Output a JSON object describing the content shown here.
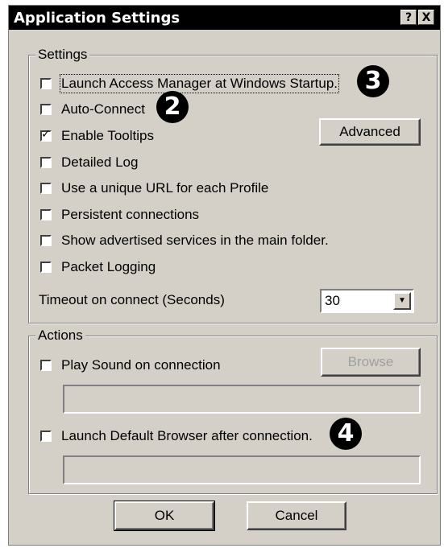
{
  "window": {
    "title": "Application Settings",
    "help_label": "?",
    "close_label": "X"
  },
  "settings": {
    "legend": "Settings",
    "options": [
      {
        "label": "Launch Access Manager at Windows Startup.",
        "checked": false
      },
      {
        "label": "Auto-Connect",
        "checked": false
      },
      {
        "label": "Enable Tooltips",
        "checked": true
      },
      {
        "label": "Detailed Log",
        "checked": false
      },
      {
        "label": "Use a unique URL for each Profile",
        "checked": false
      },
      {
        "label": "Persistent connections",
        "checked": false
      },
      {
        "label": "Show advertised services in the main folder.",
        "checked": false
      },
      {
        "label": "Packet Logging",
        "checked": false
      }
    ],
    "advanced_label": "Advanced",
    "timeout_label": "Timeout on connect (Seconds)",
    "timeout_value": "30"
  },
  "actions": {
    "legend": "Actions",
    "play_sound_label": "Play Sound on connection",
    "browse_label": "Browse",
    "launch_browser_label": "Launch Default Browser after connection."
  },
  "footer": {
    "ok_label": "OK",
    "cancel_label": "Cancel"
  },
  "callouts": [
    "3",
    "2",
    "4"
  ]
}
